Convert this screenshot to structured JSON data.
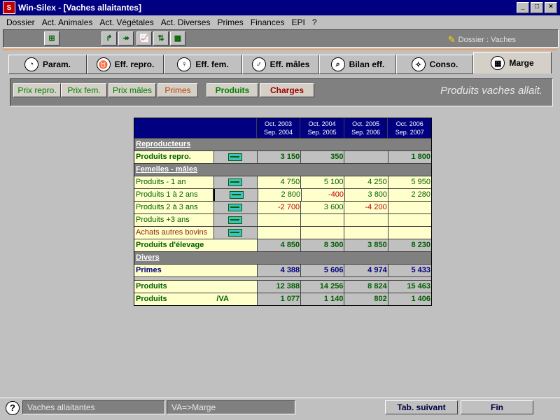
{
  "window": {
    "title": "Win-Silex - [Vaches allaitantes]"
  },
  "menu": [
    "Dossier",
    "Act. Animales",
    "Act. Végétales",
    "Act. Diverses",
    "Primes",
    "Finances",
    "EPI",
    "?"
  ],
  "toolbar": {
    "dossier_label": "Dossier : Vaches"
  },
  "tabs": [
    {
      "label": "Param.",
      "icon": "gauge-icon"
    },
    {
      "label": "Eff. repro.",
      "icon": "cow-icon"
    },
    {
      "label": "Eff. fem.",
      "icon": "female-icon"
    },
    {
      "label": "Eff. mâles",
      "icon": "male-icon"
    },
    {
      "label": "Bilan eff.",
      "icon": "report-icon"
    },
    {
      "label": "Conso.",
      "icon": "compass-icon"
    },
    {
      "label": "Marge",
      "icon": "calculator-icon"
    }
  ],
  "subtabs": {
    "prix_repro": "Prix repro.",
    "prix_fem": "Prix fem.",
    "prix_males": "Prix mâles",
    "primes": "Primes",
    "produits": "Produits",
    "charges": "Charges",
    "section_title": "Produits vaches allait."
  },
  "table": {
    "periods": [
      [
        "Oct. 2003",
        "Sep. 2004"
      ],
      [
        "Oct. 2004",
        "Sep. 2005"
      ],
      [
        "Oct. 2005",
        "Sep. 2006"
      ],
      [
        "Oct. 2006",
        "Sep. 2007"
      ]
    ],
    "sections": {
      "reproducteurs": "Reproducteurs",
      "femelles_males": "Femelles - mâles",
      "divers": "Divers"
    },
    "produits_repro": {
      "label": "Produits repro.",
      "values": [
        "3 150",
        "350",
        "",
        "1 800"
      ]
    },
    "rows_fm": [
      {
        "label": "Produits - 1 an",
        "values": [
          "4 750",
          "5 100",
          "4 250",
          "5 950"
        ]
      },
      {
        "label": "Produits 1 à 2 ans",
        "values": [
          "2 800",
          "-400",
          "3 800",
          "2 280"
        ]
      },
      {
        "label": "Produits 2 à 3 ans",
        "values": [
          "-2 700",
          "3 600",
          "-4 200",
          ""
        ]
      },
      {
        "label": "Produits +3 ans",
        "values": [
          "",
          "",
          "",
          ""
        ]
      },
      {
        "label": "Achats autres bovins",
        "values": [
          "",
          "",
          "",
          ""
        ]
      }
    ],
    "produits_elevage": {
      "label": "Produits d'élevage",
      "values": [
        "4 850",
        "8 300",
        "3 850",
        "8 230"
      ]
    },
    "primes": {
      "label": "Primes",
      "values": [
        "4 388",
        "5 606",
        "4 974",
        "5 433"
      ]
    },
    "produits": {
      "label": "Produits",
      "values": [
        "12 388",
        "14 256",
        "8 824",
        "15 463"
      ]
    },
    "produits_va": {
      "label": "Produits",
      "unit": "/VA",
      "values": [
        "1 077",
        "1 140",
        "802",
        "1 406"
      ]
    }
  },
  "status": {
    "field1": "Vaches allaitantes",
    "field2": "VA=>Marge",
    "next_tab": "Tab. suivant",
    "fin": "Fin",
    "help": "?"
  }
}
